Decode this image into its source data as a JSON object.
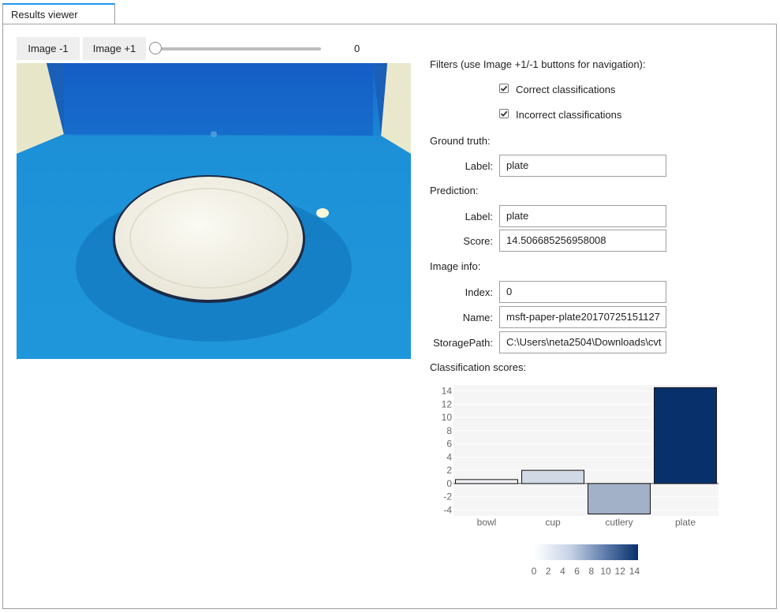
{
  "tab": {
    "label": "Results viewer"
  },
  "nav": {
    "prev_label": "Image -1",
    "next_label": "Image +1",
    "slider_value": "0"
  },
  "filters": {
    "title": "Filters (use Image +1/-1 buttons for navigation):",
    "correct_label": "Correct classifications",
    "correct_checked": true,
    "incorrect_label": "Incorrect classifications",
    "incorrect_checked": true
  },
  "ground_truth": {
    "title": "Ground truth:",
    "label_caption": "Label:",
    "label_value": "plate"
  },
  "prediction": {
    "title": "Prediction:",
    "label_caption": "Label:",
    "label_value": "plate",
    "score_caption": "Score:",
    "score_value": "14.506685256958008"
  },
  "image_info": {
    "title": "Image info:",
    "index_caption": "Index:",
    "index_value": "0",
    "name_caption": "Name:",
    "name_value": "msft-paper-plate20170725151127",
    "path_caption": "StoragePath:",
    "path_value": "C:\\Users\\neta2504\\Downloads\\cvt"
  },
  "scores_title": "Classification scores:",
  "colors": {
    "tab_accent": "#2196f3",
    "bar_scale_low": "#ffffff",
    "bar_scale_high": "#08306b",
    "photo_background": "#1a8fd6"
  },
  "chart_data": {
    "type": "bar",
    "categories": [
      "bowl",
      "cup",
      "cutlery",
      "plate"
    ],
    "values": [
      0.6,
      2.0,
      -4.6,
      14.5
    ],
    "ylim": [
      -4.9,
      14.9
    ],
    "yticks": [
      "14",
      "12",
      "10",
      "8",
      "6",
      "4",
      "2",
      "0",
      "-2",
      "-4"
    ],
    "colorbar_ticks": [
      "0",
      "2",
      "4",
      "6",
      "8",
      "10",
      "12",
      "14"
    ],
    "colorbar_range": [
      0,
      14.5
    ],
    "grid": true,
    "legend": "colorbar-bottom"
  }
}
